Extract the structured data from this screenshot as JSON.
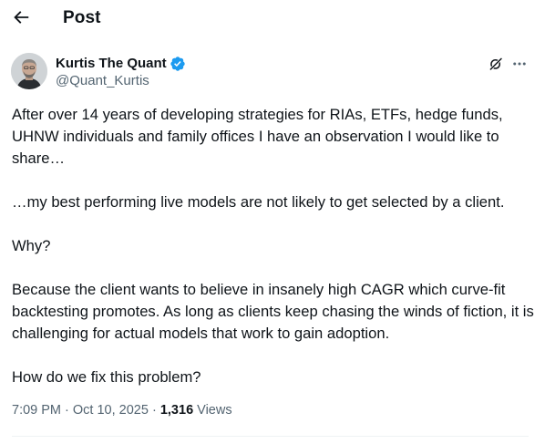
{
  "header": {
    "title": "Post"
  },
  "author": {
    "display_name": "Kurtis The Quant",
    "handle": "@Quant_Kurtis",
    "verified": true,
    "verified_color": "#1d9bf0"
  },
  "tweet": {
    "paragraphs": [
      "After over 14 years of developing strategies for RIAs, ETFs, hedge funds, UHNW individuals and family offices I have an observation I would like to share…",
      "…my best performing live models are not likely to get selected by a client.",
      "Why?",
      "Because the client wants to believe in insanely high CAGR which curve-fit backtesting promotes. As long as clients keep chasing the winds of fiction, it is challenging for actual models that work to gain adoption.",
      "How do we fix this problem?"
    ]
  },
  "meta": {
    "time": "7:09 PM",
    "date": "Oct 10, 2025",
    "separator": "·",
    "views_count": "1,316",
    "views_label": "Views"
  },
  "icons": {
    "back": "arrow-left-icon",
    "verified": "verified-badge-icon",
    "grok": "grok-icon",
    "more": "more-horizontal-icon"
  },
  "colors": {
    "text_primary": "#0f1419",
    "text_secondary": "#536471",
    "accent": "#1d9bf0",
    "divider": "#eff3f4"
  }
}
